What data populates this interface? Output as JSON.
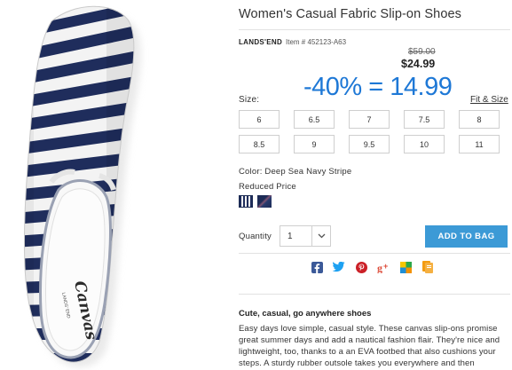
{
  "product": {
    "title": "Women's Casual Fabric Slip-on Shoes",
    "brand": "LANDS'END",
    "item_number": "Item # 452123-A63",
    "old_price": "$59.00",
    "new_price": "$24.99",
    "promo_text": "-40% = 14.99",
    "shoe_branding": "Canvas",
    "shoe_subbrand": "LANDS' END"
  },
  "size": {
    "label": "Size:",
    "fit_link": "Fit & Size",
    "options": [
      "6",
      "6.5",
      "7",
      "7.5",
      "8",
      "8.5",
      "9",
      "9.5",
      "10",
      "11"
    ]
  },
  "color": {
    "label": "Color: Deep Sea Navy Stripe",
    "reduced_label": "Reduced Price",
    "swatches": [
      {
        "name": "Deep Sea Navy Stripe",
        "hex": "#1f2d5c"
      },
      {
        "name": "Navy Print",
        "hex": "#1d2b56"
      }
    ]
  },
  "quantity": {
    "label": "Quantity",
    "value": "1"
  },
  "cart": {
    "add_label": "ADD TO BAG",
    "accent_color": "#3c9ad6"
  },
  "social": [
    "facebook-icon",
    "twitter-icon",
    "pinterest-icon",
    "google-plus-icon",
    "wishlist-icon",
    "bookmark-icon"
  ],
  "description": {
    "title": "Cute, casual, go anywhere shoes",
    "body": "Easy days love simple, casual style. These canvas slip-ons promise great summer days and add a nautical fashion flair. They're nice and lightweight, too, thanks to a an EVA footbed that also cushions your steps. A sturdy rubber outsole takes you everywhere and then"
  },
  "colors": {
    "promo": "#1e78d6",
    "stripe_navy": "#1f2d5c"
  }
}
